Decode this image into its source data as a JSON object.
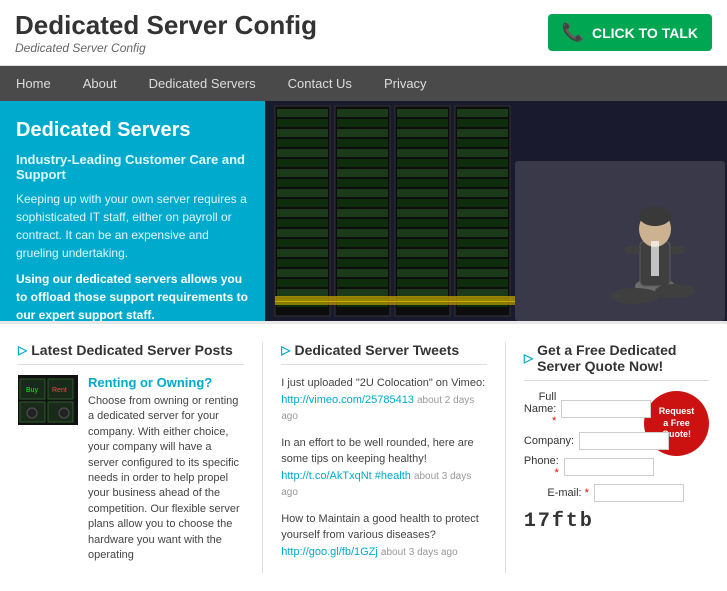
{
  "header": {
    "title": "Dedicated Server Config",
    "subtitle": "Dedicated Server Config",
    "cta_label": "CLICK TO TALK"
  },
  "nav": {
    "items": [
      {
        "label": "Home",
        "active": false
      },
      {
        "label": "About",
        "active": false
      },
      {
        "label": "Dedicated Servers",
        "active": false
      },
      {
        "label": "Contact Us",
        "active": false
      },
      {
        "label": "Privacy",
        "active": false
      }
    ]
  },
  "hero": {
    "heading": "Dedicated Servers",
    "subtitle": "Industry-Leading Customer Care and Support",
    "body1": "Keeping up with your own server requires a sophisticated IT staff, either on payroll or contract. It can be an expensive and grueling undertaking.",
    "body2": "Using our dedicated servers allows you to offload those support requirements to our expert support staff."
  },
  "posts": {
    "section_title": "Latest Dedicated Server Posts",
    "arrow": "▷",
    "post": {
      "title": "Renting or Owning?",
      "body": "Choose from owning or renting a dedicated server for your company. With either choice, your company will have a server configured to its specific needs in order to help propel your business ahead of the competition. Our flexible server plans allow you to choose the hardware you want with the operating",
      "thumb_lines": [
        "Buy",
        "Rent"
      ]
    }
  },
  "tweets": {
    "section_title": "Dedicated Server Tweets",
    "arrow": "▷",
    "items": [
      {
        "text": "I just uploaded \"2U Colocation\" on Vimeo:",
        "link": "http://vimeo.com/25785413",
        "link_time": "about 2 days ago"
      },
      {
        "text": "In an effort to be well rounded, here are some tips on keeping healthy!",
        "link": "http://t.co/AkTxqNt",
        "hashtag": "#health",
        "link_time": "about 3 days ago"
      },
      {
        "text": "How to Maintain a good health to protect yourself from various diseases?",
        "link": "http://goo.gl/fb/1GZj",
        "link_time": "about 3 days ago"
      }
    ]
  },
  "quote": {
    "section_title": "Get a Free Dedicated Server Quote Now!",
    "arrow": "▷",
    "badge_line1": "Request",
    "badge_line2": "a Free",
    "badge_line3": "Quote!",
    "fields": [
      {
        "label": "Full Name:",
        "required": true
      },
      {
        "label": "Company:",
        "required": false
      },
      {
        "label": "Phone:",
        "required": true
      },
      {
        "label": "E-mail:",
        "required": true
      }
    ],
    "captcha": "17ftb"
  }
}
